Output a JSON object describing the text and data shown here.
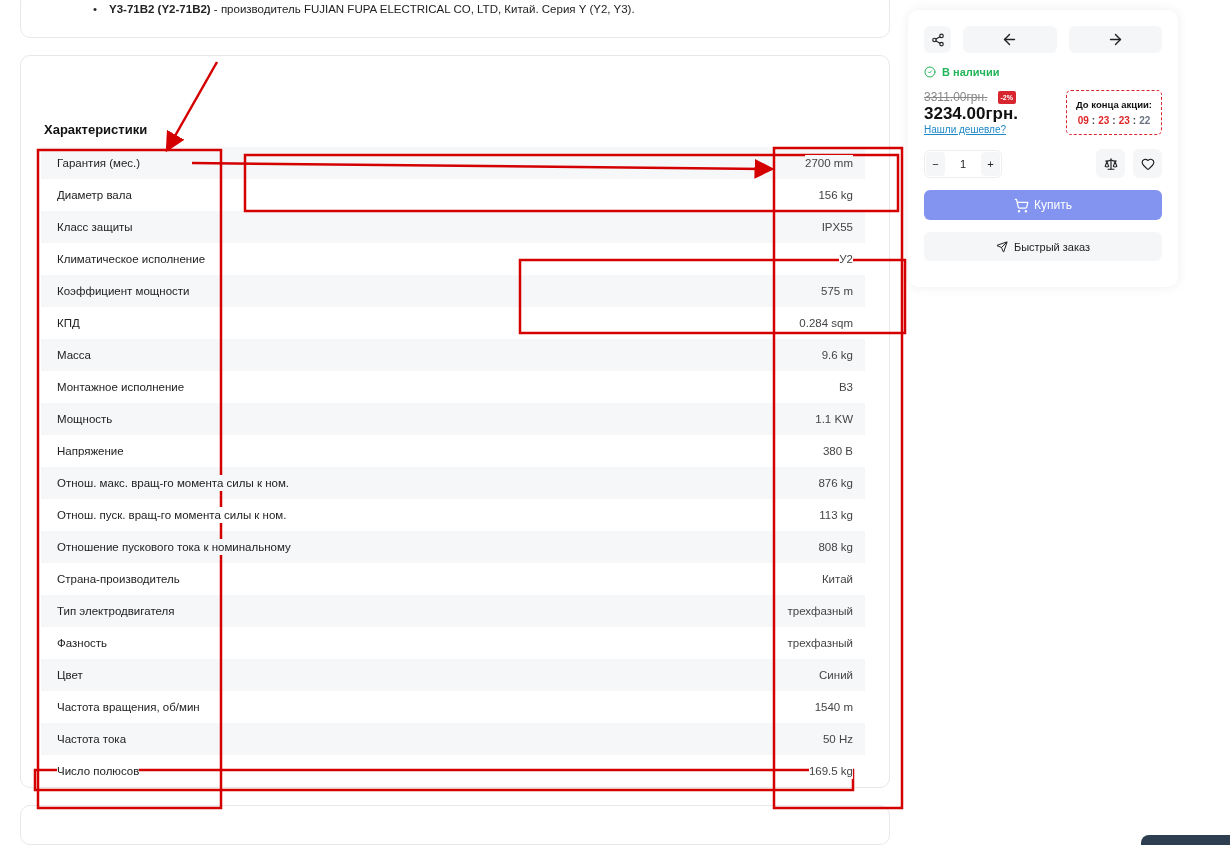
{
  "intro": {
    "bullet": "•",
    "text": "**Y3-71B2 (Y2-71B2)** - производитель FUJIAN FUPA ELECTRICAL CO, LTD, Китай. Серия Y (Y2, Y3)."
  },
  "specs": {
    "title": "Характеристики",
    "rows": [
      {
        "label": "Гарантия (мес.)",
        "value": "2700 mm"
      },
      {
        "label": "Диаметр вала",
        "value": "156 kg"
      },
      {
        "label": "Класс защиты",
        "value": "IPX55"
      },
      {
        "label": "Климатическое исполнение",
        "value": "У2"
      },
      {
        "label": "Коэффициент мощности",
        "value": "575 m"
      },
      {
        "label": "КПД",
        "value": "0.284 sqm"
      },
      {
        "label": "Масса",
        "value": "9.6 kg"
      },
      {
        "label": "Монтажное исполнение",
        "value": "В3"
      },
      {
        "label": "Мощность",
        "value": "1.1 KW"
      },
      {
        "label": "Напряжение",
        "value": "380 В"
      },
      {
        "label": "Отнош. макс. вращ-го момента силы к ном.",
        "value": "876 kg"
      },
      {
        "label": "Отнош. пуск. вращ-го момента силы к ном.",
        "value": "113 kg"
      },
      {
        "label": "Отношение пускового тока к номинальному",
        "value": "808 kg"
      },
      {
        "label": "Страна-производитель",
        "value": "Китай"
      },
      {
        "label": "Тип электродвигателя",
        "value": "трехфазный"
      },
      {
        "label": "Фазность",
        "value": "трехфазный"
      },
      {
        "label": "Цвет",
        "value": "Синий"
      },
      {
        "label": "Частота вращения, об/мин",
        "value": "1540 m"
      },
      {
        "label": "Частота тока",
        "value": "50 Hz"
      },
      {
        "label": "Число полюсов",
        "value": "169.5 kg"
      }
    ]
  },
  "buy_panel": {
    "stock": "В наличии",
    "old_price": "3311.00грн.",
    "discount": "-2%",
    "price": "3234.00грн.",
    "cheaper_link": "Нашли дешевле?",
    "timer": {
      "label": "До конца акции:",
      "separator": ":",
      "units": [
        {
          "value": "09",
          "color": "#dc2626"
        },
        {
          "value": "23",
          "color": "#dc2626"
        },
        {
          "value": "23",
          "color": "#dc2626"
        },
        {
          "value": "22",
          "color": "#6b7280"
        }
      ]
    },
    "quantity": {
      "minus": "−",
      "value": "1",
      "plus": "+"
    },
    "buy_button": "Купить",
    "quick_order_button": "Быстрый заказ"
  }
}
